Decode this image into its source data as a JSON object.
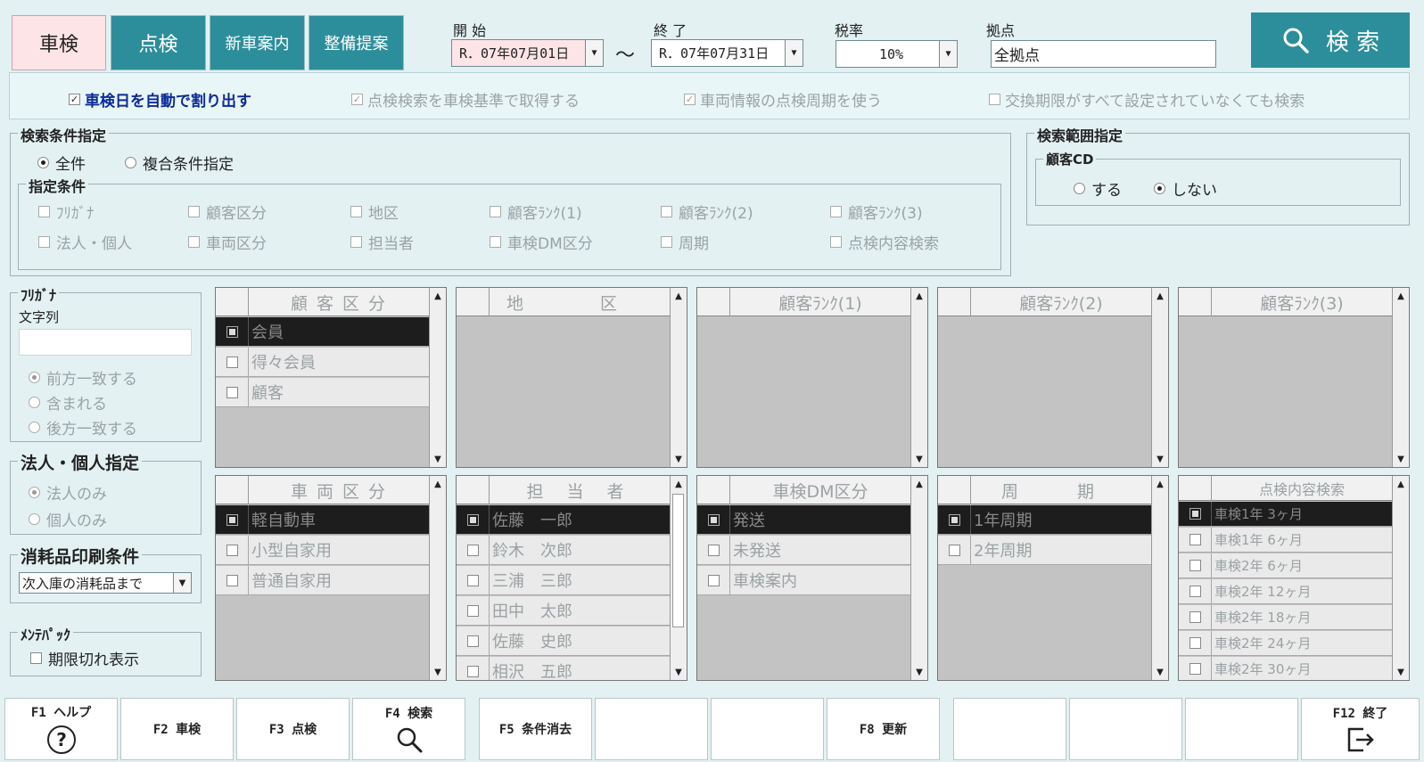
{
  "tabs": [
    {
      "label": "車検",
      "active": true
    },
    {
      "label": "点検",
      "active": false
    },
    {
      "label": "新車案内",
      "active": false
    },
    {
      "label": "整備提案",
      "active": false
    }
  ],
  "header": {
    "start_label": "開 始",
    "start_value": "R．07年07月01日",
    "tilde": "～",
    "end_label": "終 了",
    "end_value": "R．07年07月31日",
    "tax_label": "税率",
    "tax_value": "10%",
    "base_label": "拠点",
    "base_value": "全拠点",
    "search_label": "検 索"
  },
  "options": [
    {
      "label": "車検日を自動で割り出す",
      "checked": true,
      "enabled": true
    },
    {
      "label": "点検検索を車検基準で取得する",
      "checked": true,
      "enabled": false
    },
    {
      "label": "車両情報の点検周期を使う",
      "checked": true,
      "enabled": false
    },
    {
      "label": "交換期限がすべて設定されていなくても検索",
      "checked": false,
      "enabled": false
    }
  ],
  "conditions": {
    "title": "検索条件指定",
    "all_label": "全件",
    "compound_label": "複合条件指定",
    "specified_title": "指定条件",
    "items": [
      "ﾌﾘｶﾞﾅ",
      "顧客区分",
      "地区",
      "顧客ﾗﾝｸ(1)",
      "顧客ﾗﾝｸ(2)",
      "顧客ﾗﾝｸ(3)",
      "法人・個人",
      "車両区分",
      "担当者",
      "車検DM区分",
      "周期",
      "点検内容検索"
    ]
  },
  "range": {
    "title": "検索範囲指定",
    "sub_title": "顧客CD",
    "yes_label": "する",
    "no_label": "しない"
  },
  "furigana": {
    "title": "ﾌﾘｶﾞﾅ",
    "string_label": "文字列",
    "value": "",
    "match_options": [
      "前方一致する",
      "含まれる",
      "後方一致する"
    ]
  },
  "corp": {
    "title": "法人・個人指定",
    "options": [
      "法人のみ",
      "個人のみ"
    ]
  },
  "consumables": {
    "title": "消耗品印刷条件",
    "value": "次入庫の消耗品まで"
  },
  "mainte": {
    "title": "ﾒﾝﾃﾊﾟｯｸ",
    "expired_label": "期限切れ表示"
  },
  "lists": {
    "customer_class": {
      "title": "顧 客 区 分",
      "rows": [
        "会員",
        "得々会員",
        "顧客"
      ]
    },
    "area": {
      "title": "地 区",
      "rows": []
    },
    "rank1": {
      "title": "顧客ﾗﾝｸ(1)",
      "rows": []
    },
    "rank2": {
      "title": "顧客ﾗﾝｸ(2)",
      "rows": []
    },
    "rank3": {
      "title": "顧客ﾗﾝｸ(3)",
      "rows": []
    },
    "vehicle_class": {
      "title": "車 両 区 分",
      "rows": [
        "軽自動車",
        "小型自家用",
        "普通自家用"
      ]
    },
    "staff": {
      "title": "担 当 者",
      "rows": [
        "佐藤　一郎",
        "鈴木　次郎",
        "三浦　三郎",
        "田中　太郎",
        "佐藤　史郎",
        "相沢　五郎"
      ]
    },
    "dm_class": {
      "title": "車検DM区分",
      "rows": [
        "発送",
        "未発送",
        "車検案内"
      ]
    },
    "cycle": {
      "title": "周 期",
      "rows": [
        "1年周期",
        "2年周期"
      ]
    },
    "inspection": {
      "title": "点検内容検索",
      "rows": [
        "車検1年 3ヶ月",
        "車検1年 6ヶ月",
        "車検2年 6ヶ月",
        "車検2年 12ヶ月",
        "車検2年 18ヶ月",
        "車検2年 24ヶ月",
        "車検2年 30ヶ月"
      ]
    }
  },
  "fkeys": [
    {
      "label": "F1 ヘルプ",
      "icon": "help-icon"
    },
    {
      "label": "F2 車検"
    },
    {
      "label": "F3 点検"
    },
    {
      "label": "F4 検索",
      "icon": "search-icon"
    },
    {
      "label": "F5 条件消去"
    },
    {
      "label": ""
    },
    {
      "label": ""
    },
    {
      "label": "F8 更新"
    },
    {
      "label": ""
    },
    {
      "label": ""
    },
    {
      "label": ""
    },
    {
      "label": "F12 終了",
      "icon": "exit-icon"
    }
  ],
  "colors": {
    "accent": "#2c8e9a",
    "active_tab": "#fde4e6",
    "background": "#e3f1f3"
  }
}
